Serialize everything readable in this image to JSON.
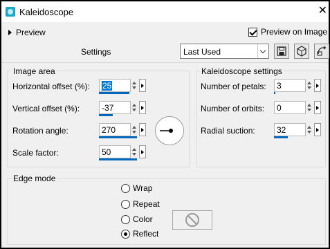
{
  "window": {
    "title": "Kaleidoscope",
    "close_icon": "close-icon"
  },
  "toolbar": {
    "preview_label": "Preview",
    "preview_on_image_label": "Preview on Image",
    "preview_on_image_checked": true,
    "settings_label": "Settings",
    "preset_value": "Last Used",
    "icons": [
      "save-preset-icon",
      "reset-preset-icon",
      "randomize-icon"
    ]
  },
  "image_area": {
    "title": "Image area",
    "horizontal_offset": {
      "label": "Horizontal offset (%):",
      "value": "25"
    },
    "vertical_offset": {
      "label": "Vertical offset (%):",
      "value": "-37"
    },
    "rotation_angle": {
      "label": "Rotation angle:",
      "value": "270"
    },
    "scale_factor": {
      "label": "Scale factor:",
      "value": "50"
    }
  },
  "kaleidoscope_settings": {
    "title": "Kaleidoscope settings",
    "petals": {
      "label": "Number of petals:",
      "value": "3"
    },
    "orbits": {
      "label": "Number of orbits:",
      "value": "0"
    },
    "radial_suction": {
      "label": "Radial suction:",
      "value": "32"
    }
  },
  "edge_mode": {
    "title": "Edge mode",
    "options": [
      "Wrap",
      "Repeat",
      "Color",
      "Reflect"
    ],
    "selected": "Reflect"
  },
  "colors": {
    "accent": "#0078d7",
    "bar": "#0067c0",
    "app_icon": "#1aa6c9"
  }
}
